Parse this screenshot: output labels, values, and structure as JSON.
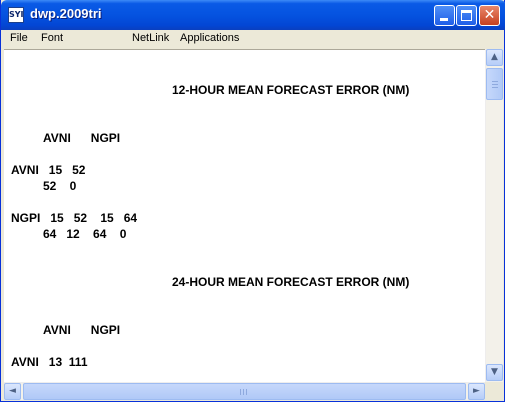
{
  "window": {
    "title": "dwp.2009tri",
    "icon": "app-icon"
  },
  "title_buttons": {
    "minimize": "minimize-icon",
    "maximize": "maximize-icon",
    "close": "close-icon",
    "close_glyph": "✕"
  },
  "menu": {
    "items": [
      "File",
      "Font",
      "NetLink",
      "Applications"
    ]
  },
  "content": {
    "lines": [
      "12-HOUR MEAN FORECAST ERROR (NM)",
      "AVNI      NGPI",
      "AVNI   15   52",
      "52    0",
      "NGPI   15   52    15   64",
      "64   12    64    0",
      "24-HOUR MEAN FORECAST ERROR (NM)",
      "AVNI      NGPI",
      "AVNI   13  111"
    ]
  },
  "scrollbars": {
    "up": "▲",
    "down": "▼",
    "left": "◄",
    "right": "►"
  }
}
